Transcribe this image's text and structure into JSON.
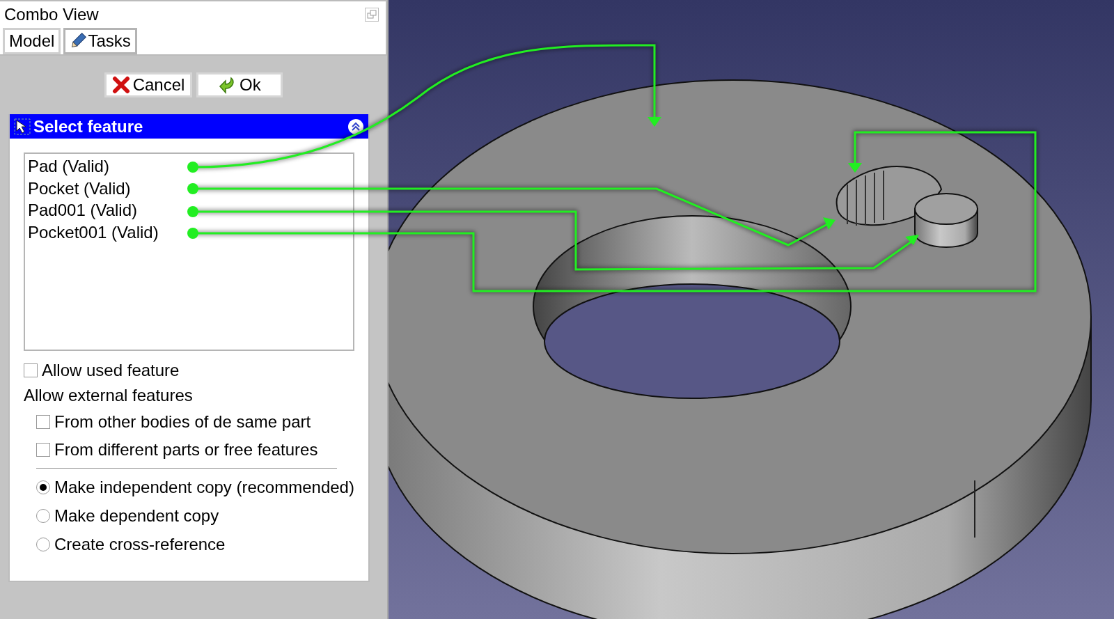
{
  "window": {
    "title": "Combo View"
  },
  "tabs": [
    {
      "label": "Model",
      "selected": false
    },
    {
      "label": "Tasks",
      "selected": true
    }
  ],
  "buttons": [
    {
      "label": "Cancel",
      "kind": "cancel"
    },
    {
      "label": "Ok",
      "kind": "ok"
    }
  ],
  "task_panel": {
    "title": "Select feature",
    "expanded": true,
    "features": [
      {
        "label": "Pad (Valid)"
      },
      {
        "label": "Pocket (Valid)"
      },
      {
        "label": "Pad001 (Valid)"
      },
      {
        "label": "Pocket001 (Valid)"
      }
    ],
    "allow_used": {
      "label": "Allow used feature",
      "checked": false
    },
    "external_label": "Allow external features",
    "external_options": [
      {
        "label": "From other bodies of de same part",
        "checked": false
      },
      {
        "label": "From different parts or free features",
        "checked": false
      }
    ],
    "copy_modes": [
      {
        "label": "Make independent copy (recommended)",
        "selected": true
      },
      {
        "label": "Make dependent copy",
        "selected": false
      },
      {
        "label": "Create cross-reference",
        "selected": false
      }
    ]
  }
}
